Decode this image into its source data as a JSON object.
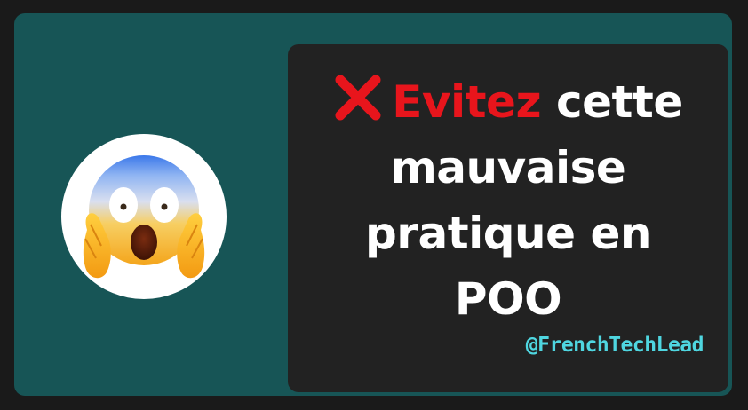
{
  "headline": {
    "icon": "cross-mark-icon",
    "highlight": "Evitez",
    "line1_rest": " cette",
    "line2": "mauvaise",
    "line3": "pratique en",
    "line4": "POO"
  },
  "handle": "@FrenchTechLead",
  "avatar": {
    "icon": "screaming-in-fear-emoji-icon"
  },
  "colors": {
    "background": "#1a1a1a",
    "card": "#175556",
    "panel": "#222222",
    "highlight": "#e8151c",
    "handle": "#4fd6e0",
    "text": "#ffffff"
  }
}
